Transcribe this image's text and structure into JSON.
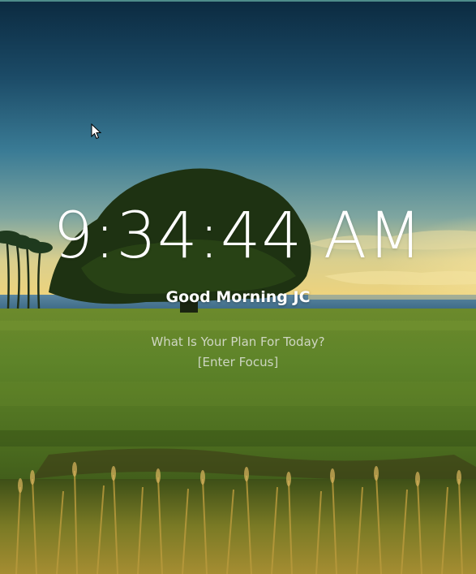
{
  "clock": {
    "time": "9:34:44 AM"
  },
  "greeting": {
    "text": "Good Morning JC"
  },
  "focus": {
    "question": "What Is Your Plan For Today?",
    "link_text": "[Enter Focus]"
  },
  "background": {
    "sky_top": "#0d2f46",
    "sky_mid": "#2f6e8a",
    "horizon": "#e9d48a",
    "ocean": "#3b6f8e",
    "grass": "#5a7d2a",
    "grass_dark": "#23340f",
    "tree": "#1c2c10"
  },
  "cursor": {
    "icon": "mouse-pointer-icon"
  }
}
